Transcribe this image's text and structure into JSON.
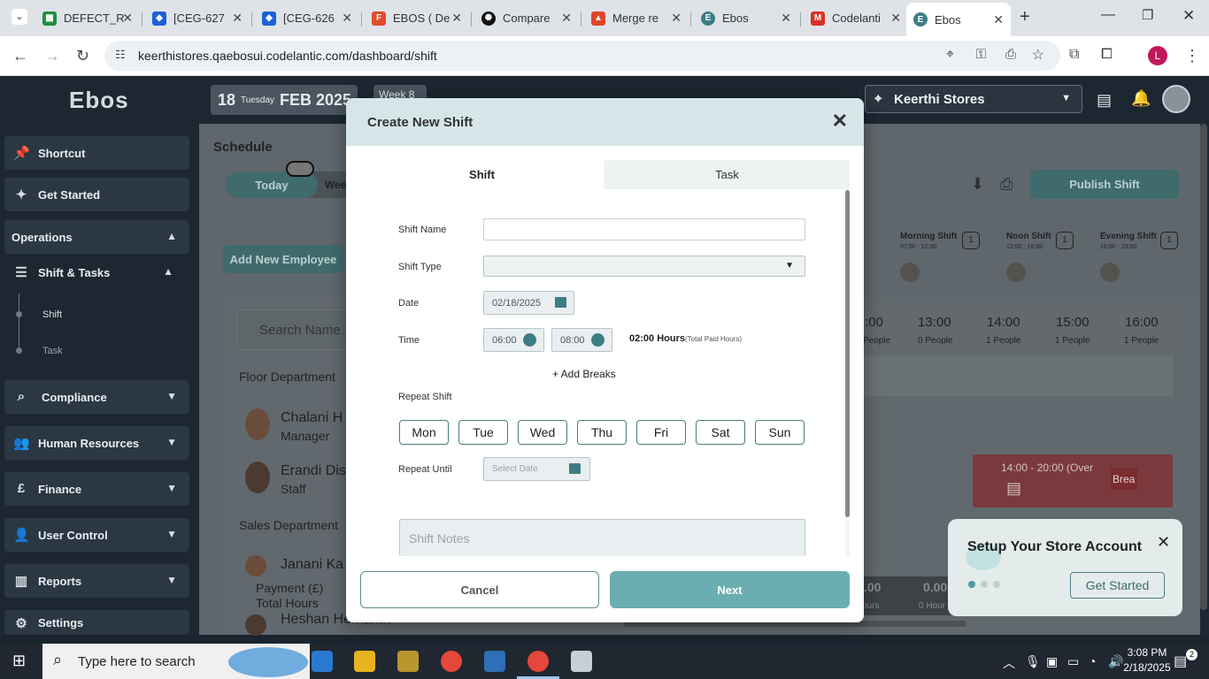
{
  "browser": {
    "tabs": [
      {
        "label": "DEFECT_R",
        "icon": "sheets-icon",
        "color": "#1e8e3e"
      },
      {
        "label": "[CEG-627",
        "icon": "jira-icon",
        "color": "#1c61d6"
      },
      {
        "label": "[CEG-626",
        "icon": "jira-icon",
        "color": "#1c61d6"
      },
      {
        "label": "EBOS ( De",
        "icon": "figma-icon",
        "color": "#e24c2c"
      },
      {
        "label": "Compare",
        "icon": "chatgpt-icon",
        "color": "#111111"
      },
      {
        "label": "Merge re",
        "icon": "gitlab-icon",
        "color": "#e2432a"
      },
      {
        "label": "Ebos",
        "icon": "ebos-icon",
        "color": "#3a7f86"
      },
      {
        "label": "Codelanti",
        "icon": "gmail-icon",
        "color": "#d93025"
      },
      {
        "label": "Ebos",
        "icon": "ebos-icon",
        "color": "#3a7f86",
        "active": true
      }
    ],
    "url": "keerthistores.qaebosui.codelantic.com/dashboard/shift",
    "profile_initial": "L"
  },
  "app": {
    "logo": "Ebos",
    "date": {
      "day": "18",
      "weekday": "Tuesday",
      "month_year": "FEB 2025",
      "week": "Week 8"
    },
    "store": "Keerthi Stores",
    "sidebar": {
      "shortcut": "Shortcut",
      "get_started": "Get Started",
      "operations": "Operations",
      "shift_tasks": "Shift & Tasks",
      "shift": "Shift",
      "task": "Task",
      "compliance": "Compliance",
      "human_resources": "Human Resources",
      "finance": "Finance",
      "user_control": "User Control",
      "reports": "Reports",
      "settings": "Settings"
    },
    "schedule": {
      "title": "Schedule",
      "today": "Today",
      "week": "Wee",
      "add_employee": "Add New Employee",
      "search_placeholder": "Search Name",
      "floor_department": "Floor Department",
      "sales_department": "Sales Department",
      "employees": [
        {
          "name": "Chalani H",
          "role": "Manager"
        },
        {
          "name": "Erandi Dis",
          "role": "Staff"
        },
        {
          "name": "Janani Ka",
          "role": ""
        },
        {
          "name": "Heshan Hemanth",
          "role": ""
        }
      ],
      "payment": "Payment (£)",
      "total_hours": "Total Hours",
      "publish_shift": "Publish Shift",
      "shift_types": [
        {
          "name": "Morning Shift",
          "time": "07:00 - 12:00",
          "count": "1"
        },
        {
          "name": "Noon Shift",
          "time": "12:00 - 16:00",
          "count": "1"
        },
        {
          "name": "Evening Shift",
          "time": "16:00 - 23:00",
          "count": "1"
        }
      ],
      "hours": [
        {
          "time": ":00",
          "people": "People"
        },
        {
          "time": "13:00",
          "people": "0 People"
        },
        {
          "time": "14:00",
          "people": "1 People"
        },
        {
          "time": "15:00",
          "people": "1 People"
        },
        {
          "time": "16:00",
          "people": "1 People"
        }
      ],
      "shift_block": "14:00 - 20:00 (Over",
      "break_label": "Brea",
      "totals": [
        ".00",
        "0.00"
      ],
      "totals_unit": [
        "ours",
        "0 Hour"
      ]
    },
    "setup_popup": {
      "title": "Setup Your Store Account",
      "button": "Get Started"
    }
  },
  "modal": {
    "title": "Create New Shift",
    "tabs": [
      "Shift",
      "Task"
    ],
    "labels": {
      "shift_name": "Shift Name",
      "shift_type": "Shift Type",
      "date": "Date",
      "time": "Time",
      "repeat_shift": "Repeat Shift",
      "repeat_until": "Repeat Until"
    },
    "date_value": "02/18/2025",
    "time_start": "06:00",
    "time_end": "08:00",
    "hours_total": "02:00 Hours",
    "hours_note": "(Total Paid Hours)",
    "add_breaks": "+ Add Breaks",
    "days": [
      "Mon",
      "Tue",
      "Wed",
      "Thu",
      "Fri",
      "Sat",
      "Sun"
    ],
    "repeat_until_placeholder": "Select Date",
    "notes_placeholder": "Shift Notes",
    "cancel": "Cancel",
    "next": "Next"
  },
  "taskbar": {
    "search_placeholder": "Type here to search",
    "time": "3:08 PM",
    "date": "2/18/2025",
    "notifications": "2"
  },
  "colors": {
    "accent": "#6aaeb1",
    "dark_teal": "#3e7c83",
    "modal_header": "#d6e6e8",
    "sidebar": "#1c2731"
  }
}
